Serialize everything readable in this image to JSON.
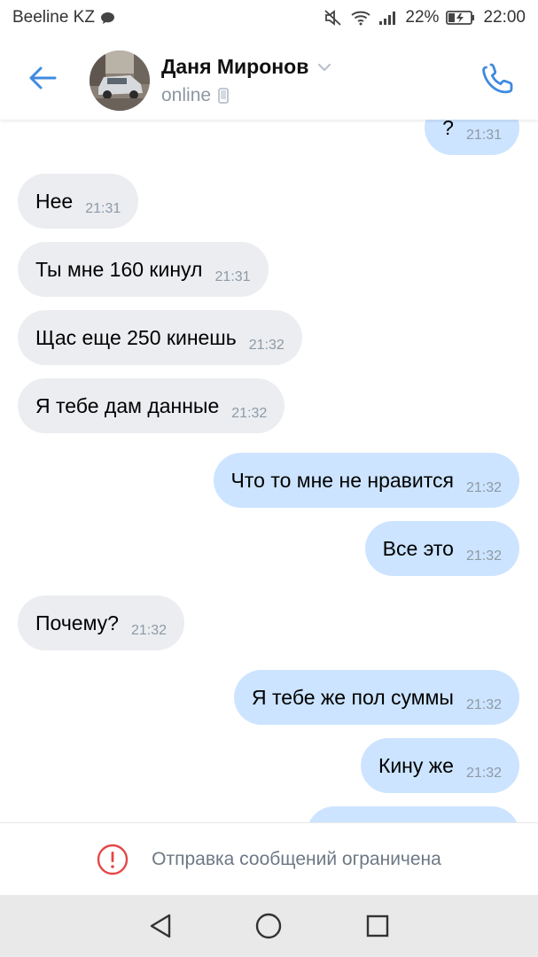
{
  "status_bar": {
    "carrier": "Beeline KZ",
    "battery_percent": "22%",
    "time": "22:00"
  },
  "header": {
    "contact_name": "Даня Миронов",
    "status": "online"
  },
  "messages": [
    {
      "direction": "out",
      "text": "?",
      "time": "21:31"
    },
    {
      "direction": "in",
      "text": "Нее",
      "time": "21:31"
    },
    {
      "direction": "in",
      "text": "Ты мне 160 кинул",
      "time": "21:31"
    },
    {
      "direction": "in",
      "text": "Щас еще 250 кинешь",
      "time": "21:32"
    },
    {
      "direction": "in",
      "text": "Я тебе дам данные",
      "time": "21:32"
    },
    {
      "direction": "out",
      "text": "Что то мне не нравится",
      "time": "21:32"
    },
    {
      "direction": "out",
      "text": "Все это",
      "time": "21:32"
    },
    {
      "direction": "in",
      "text": "Почему?",
      "time": "21:32"
    },
    {
      "direction": "out",
      "text": "Я тебе же пол суммы",
      "time": "21:32"
    },
    {
      "direction": "out",
      "text": "Кину же",
      "time": "21:32"
    },
    {
      "direction": "out",
      "text": "",
      "time": ""
    }
  ],
  "restricted_notice": "Отправка сообщений ограничена",
  "icons": {
    "back": "back-arrow-icon",
    "call": "phone-icon",
    "mobile": "mobile-device-icon",
    "chevron": "chevron-down-icon",
    "warning": "exclamation-circle-icon",
    "nav_back": "triangle-back-icon",
    "nav_home": "circle-home-icon",
    "nav_recent": "square-recents-icon"
  },
  "colors": {
    "accent": "#3f8ae0",
    "incoming_bubble": "#ebedf0",
    "outgoing_bubble": "#cce4ff",
    "warning": "#e64646"
  }
}
